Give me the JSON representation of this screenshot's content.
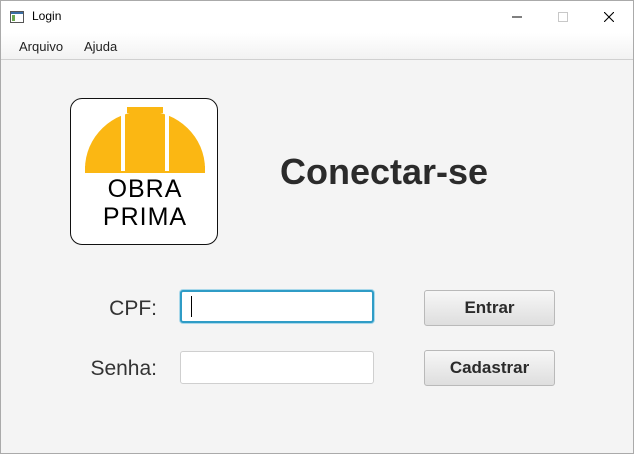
{
  "window": {
    "title": "Login"
  },
  "menu": {
    "items": [
      "Arquivo",
      "Ajuda"
    ]
  },
  "logo": {
    "line1": "OBRA",
    "line2": "PRIMA",
    "helmet_color": "#fbb713"
  },
  "heading": "Conectar-se",
  "form": {
    "cpf": {
      "label": "CPF:",
      "value": ""
    },
    "senha": {
      "label": "Senha:",
      "value": ""
    }
  },
  "buttons": {
    "entrar": "Entrar",
    "cadastrar": "Cadastrar"
  },
  "colors": {
    "focus": "#2f9cc6",
    "background": "#f4f4f4"
  }
}
